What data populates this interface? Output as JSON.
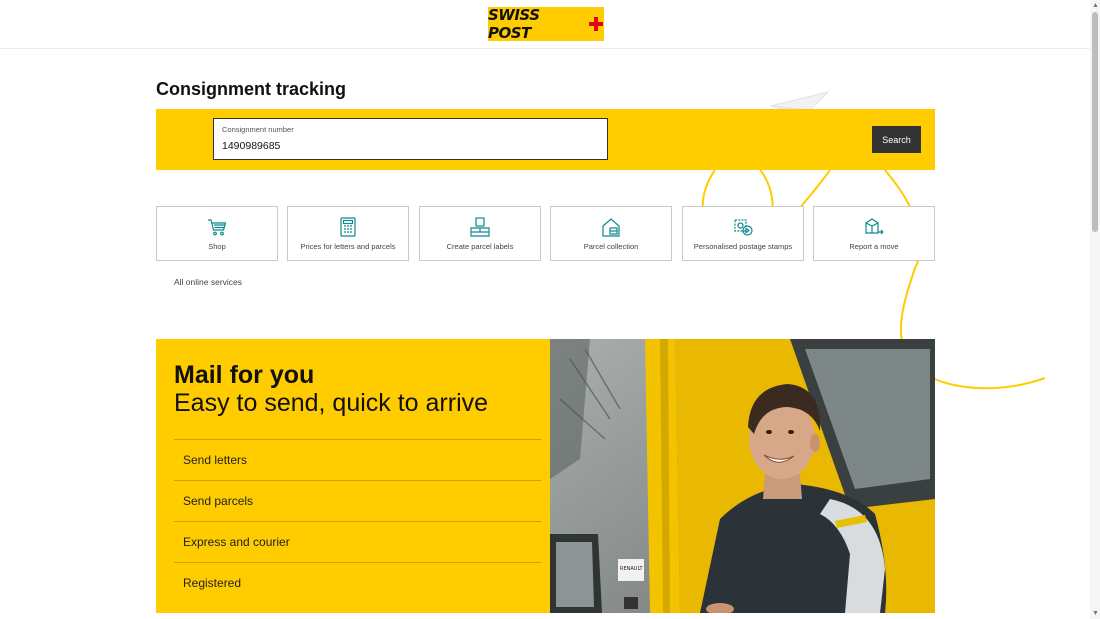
{
  "header": {
    "logo_text": "SWISS POST",
    "brand_color": "#ffcc00",
    "cross_color": "#e2001a"
  },
  "page_title": "Consignment tracking",
  "tracking": {
    "field_label": "Consignment number",
    "value": "1490989685",
    "search_label": "Search"
  },
  "services": [
    {
      "label": "Shop",
      "icon": "shopping-cart-icon"
    },
    {
      "label": "Prices for letters and parcels",
      "icon": "calculator-icon"
    },
    {
      "label": "Create parcel labels",
      "icon": "parcel-label-icon"
    },
    {
      "label": "Parcel collection",
      "icon": "house-parcel-icon"
    },
    {
      "label": "Personalised postage stamps",
      "icon": "stamp-icon"
    },
    {
      "label": "Report a move",
      "icon": "moving-boxes-icon"
    }
  ],
  "all_services_label": "All online services",
  "promo": {
    "title": "Mail for you",
    "subtitle": "Easy to send, quick to arrive",
    "items": [
      "Send letters",
      "Send parcels",
      "Express and courier",
      "Registered"
    ]
  },
  "photo": {
    "van_badge": "RENAULT"
  }
}
